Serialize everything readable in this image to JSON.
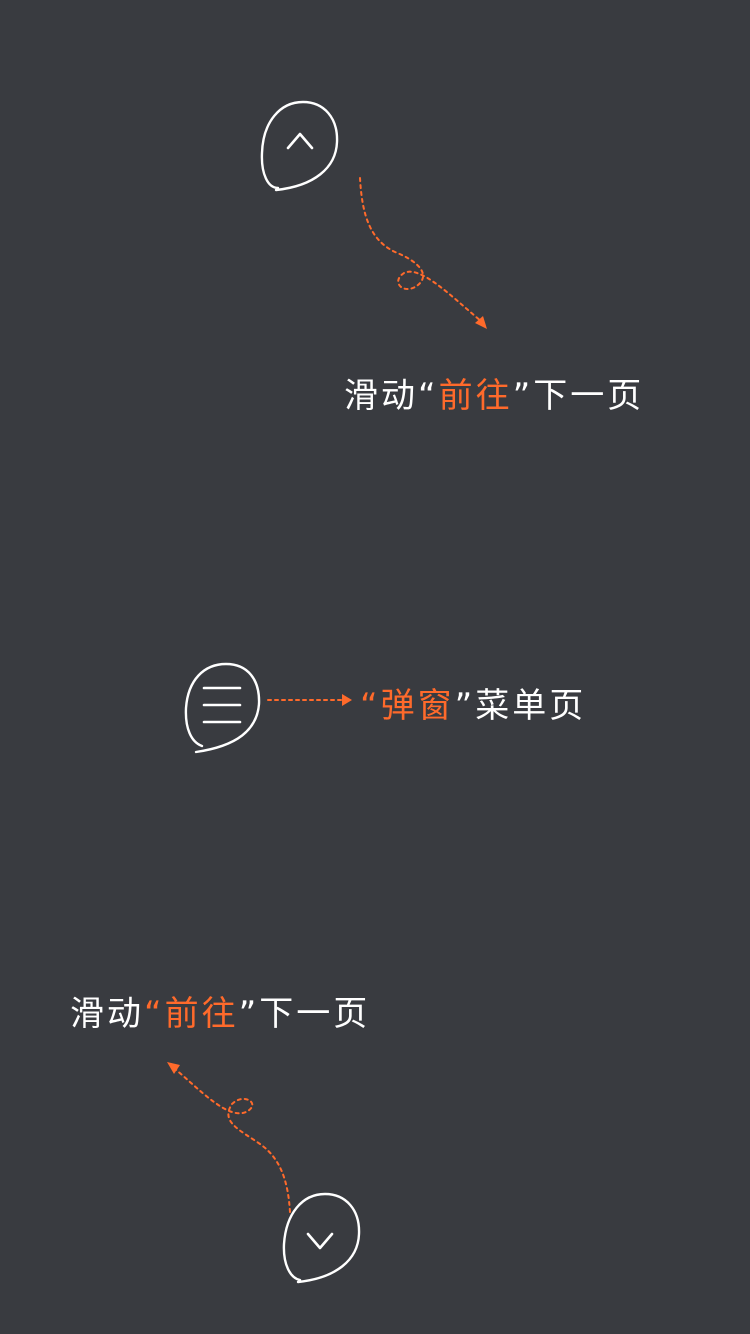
{
  "colors": {
    "background": "#393b40",
    "text": "#ffffff",
    "accent": "#ff6a2b"
  },
  "top_hint": {
    "prefix": "滑动",
    "open_quote": "“",
    "highlight": "前往",
    "close_quote": "”",
    "suffix": "下一页"
  },
  "menu_hint": {
    "open_quote": "“",
    "highlight": "弹窗",
    "close_quote": "”",
    "suffix": "菜单页"
  },
  "bottom_hint": {
    "prefix": "滑动",
    "open_quote": "“",
    "highlight": "前往",
    "close_quote": "”",
    "suffix": "下一页"
  },
  "icons": {
    "up": "chevron-up-icon",
    "menu": "hamburger-menu-icon",
    "down": "chevron-down-icon"
  }
}
